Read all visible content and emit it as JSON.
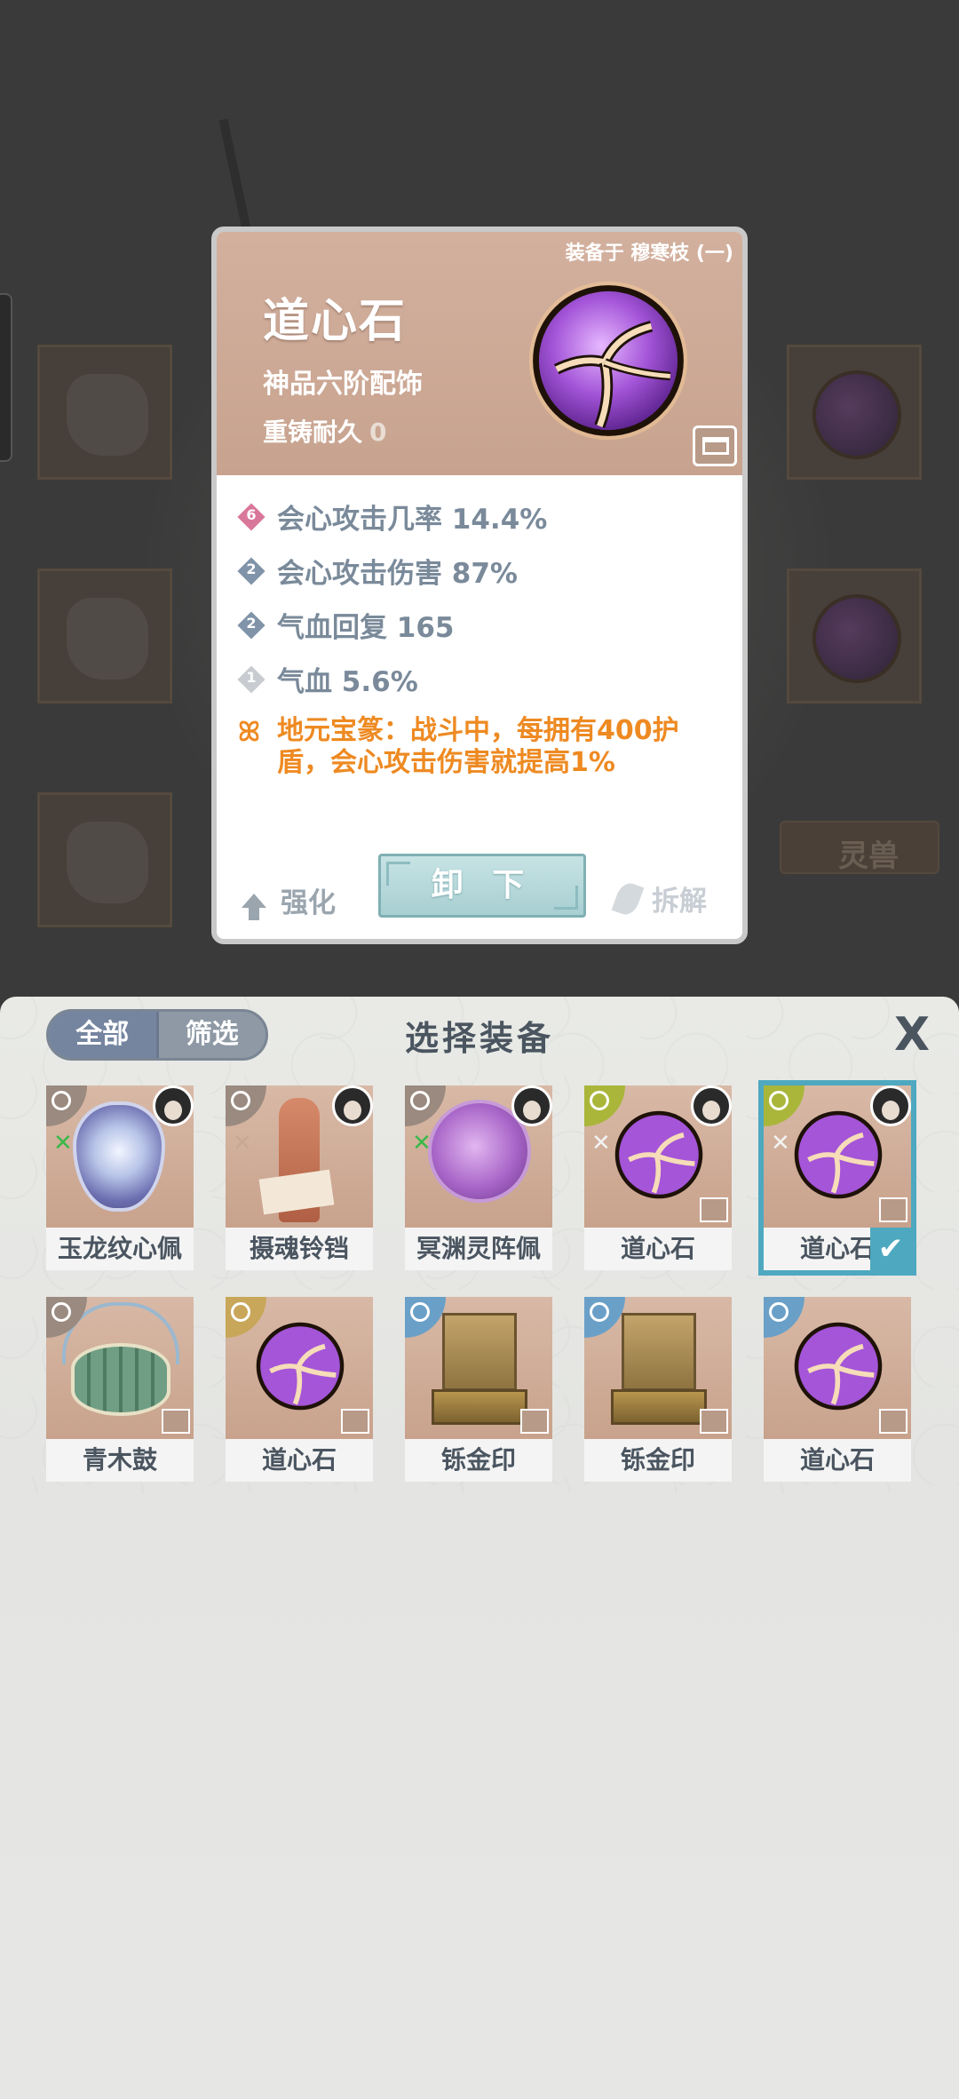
{
  "detail": {
    "equipped_on": "装备于 穆寒枝 (一)",
    "name": "道心石",
    "grade": "神品六阶配饰",
    "recast_label": "重铸耐久",
    "recast_value": "0",
    "stats": [
      {
        "level": "6",
        "text": "会心攻击几率 14.4%",
        "color": "#d9779a"
      },
      {
        "level": "2",
        "text": "会心攻击伤害 87%",
        "color": "#8093a8"
      },
      {
        "level": "2",
        "text": "气血回复 165",
        "color": "#8093a8"
      },
      {
        "level": "1",
        "text": "气血 5.6%",
        "color": "#c8ccd0"
      }
    ],
    "special": "地元宝篆：战斗中，每拥有400护盾，会心攻击伤害就提高1%",
    "upgrade_label": "强化",
    "unequip_label": "卸 下",
    "dismantle_label": "拆解",
    "orb_colors": {
      "core": "#b46ee0",
      "rim": "#f2c58f",
      "crack": "#f6e2c2"
    }
  },
  "panel": {
    "tab_all": "全部",
    "tab_filter": "筛选",
    "title": "选择装备",
    "close": "X"
  },
  "items": [
    {
      "name": "玉龙纹心佩",
      "art": "jade",
      "tag_color": "#3cb84a",
      "selected": false,
      "avatar": true,
      "lock": false
    },
    {
      "name": "摄魂铃铛",
      "art": "bell",
      "tag_color": "#c8a894",
      "selected": false,
      "avatar": true,
      "lock": false
    },
    {
      "name": "冥渊灵阵佩",
      "art": "pearl",
      "tag_color": "#3cb84a",
      "selected": false,
      "avatar": true,
      "lock": false
    },
    {
      "name": "道心石",
      "art": "orb",
      "tag_color": "#f2f2f2",
      "selected": false,
      "avatar": true,
      "lock": true
    },
    {
      "name": "道心石",
      "art": "orb",
      "tag_color": "#f2f2f2",
      "selected": true,
      "avatar": true,
      "lock": true
    },
    {
      "name": "青木鼓",
      "art": "drum",
      "tag_color": "",
      "selected": false,
      "avatar": false,
      "lock": true
    },
    {
      "name": "道心石",
      "art": "orb",
      "tag_color": "",
      "selected": false,
      "avatar": false,
      "lock": true
    },
    {
      "name": "铄金印",
      "art": "seal",
      "tag_color": "",
      "selected": false,
      "avatar": false,
      "lock": true
    },
    {
      "name": "铄金印",
      "art": "seal",
      "tag_color": "",
      "selected": false,
      "avatar": false,
      "lock": true
    },
    {
      "name": "道心石",
      "art": "orb",
      "tag_color": "",
      "selected": false,
      "avatar": false,
      "lock": true
    }
  ],
  "background": {
    "spirit_beast_label": "灵兽"
  }
}
